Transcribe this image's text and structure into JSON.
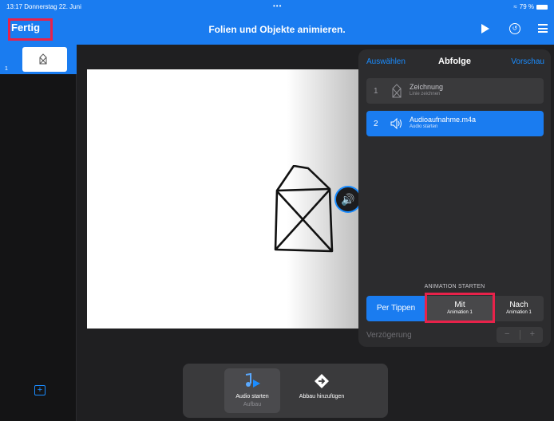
{
  "status": {
    "time_date": "13:17  Donnerstag 22. Juni",
    "battery": "79 %"
  },
  "navbar": {
    "done_label": "Fertig",
    "title": "Folien und Objekte animieren."
  },
  "navigator": {
    "slide_number": "1"
  },
  "panel": {
    "left": "Auswählen",
    "title": "Abfolge",
    "right": "Vorschau",
    "items": [
      {
        "num": "1",
        "name": "Zeichnung",
        "sub": "Linie zeichnen"
      },
      {
        "num": "2",
        "name": "Audioaufnahme.m4a",
        "sub": "Audio starten"
      }
    ],
    "start_label": "ANIMATION STARTEN",
    "options": [
      {
        "label": "Per Tippen"
      },
      {
        "label": "Mit",
        "sub": "Animation 1"
      },
      {
        "label": "Nach",
        "sub": "Animation 1"
      }
    ],
    "delay_label": "Verzögerung",
    "stepper_minus": "−",
    "stepper_plus": "+"
  },
  "toolbar": {
    "audio_label": "Audio starten",
    "audio_sub": "Aufbau",
    "build_label": "Abbau hinzufügen"
  },
  "colors": {
    "accent": "#1a7cf0",
    "highlight": "#e8224a"
  }
}
